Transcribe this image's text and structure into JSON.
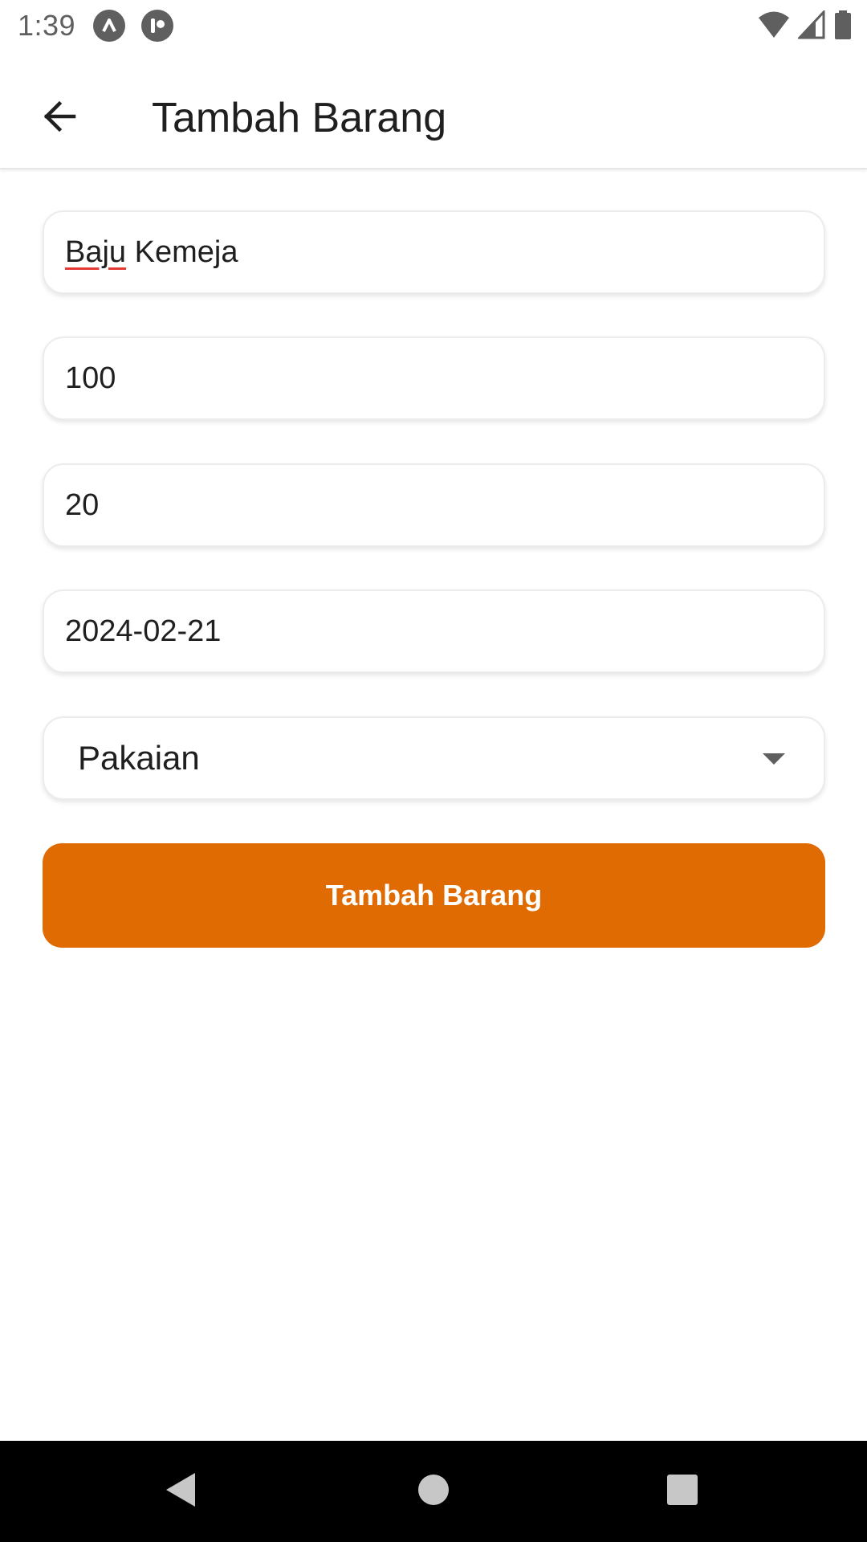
{
  "status_bar": {
    "time": "1:39",
    "icons": [
      "app-notification-icon",
      "app-notification-icon-2",
      "wifi-icon",
      "signal-icon",
      "battery-icon"
    ]
  },
  "app_bar": {
    "title": "Tambah Barang",
    "back_icon": "arrow-back-icon"
  },
  "form": {
    "name_value_part1": "Baju",
    "name_value_part2": " Kemeja",
    "price_value": "100",
    "stock_value": "20",
    "date_value": "2024-02-21",
    "category_value": "Pakaian",
    "submit_label": "Tambah Barang"
  },
  "nav_bar": {
    "icons": [
      "back-triangle-icon",
      "home-circle-icon",
      "recents-square-icon"
    ]
  },
  "colors": {
    "accent": "#e06b02",
    "spellcheck": "#e53935"
  }
}
